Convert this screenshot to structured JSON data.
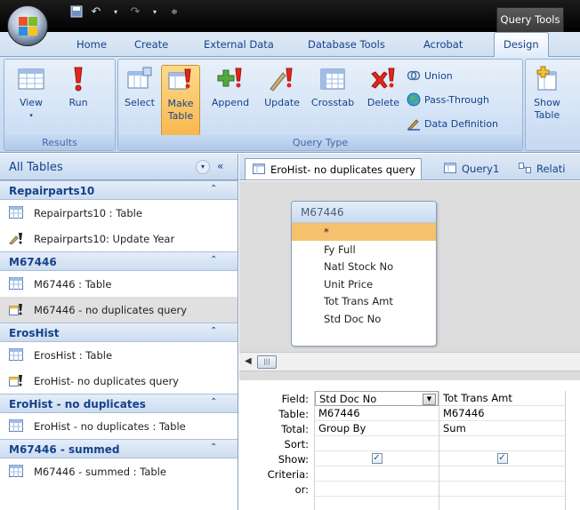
{
  "window": {
    "contextual_tab": "Query Tools"
  },
  "ribbon": {
    "tabs": [
      "Home",
      "Create",
      "External Data",
      "Database Tools",
      "Acrobat",
      "Design"
    ],
    "active_tab": "Design",
    "groups": {
      "results": {
        "label": "Results",
        "view": "View",
        "run": "Run"
      },
      "query_type": {
        "label": "Query Type",
        "select": "Select",
        "make_table_1": "Make",
        "make_table_2": "Table",
        "append": "Append",
        "update": "Update",
        "crosstab": "Crosstab",
        "delete": "Delete",
        "union": "Union",
        "pass_through": "Pass-Through",
        "data_definition": "Data Definition"
      },
      "query_setup": {
        "show_table_1": "Show",
        "show_table_2": "Table"
      }
    }
  },
  "nav": {
    "header": "All Tables",
    "groups": [
      {
        "title": "Repairparts10",
        "items": [
          {
            "label": "Repairparts10 : Table",
            "icon": "table-icon"
          },
          {
            "label": "Repairparts10: Update Year",
            "icon": "update-query-icon"
          }
        ]
      },
      {
        "title": "M67446",
        "items": [
          {
            "label": "M67446 : Table",
            "icon": "table-icon"
          },
          {
            "label": "M67446 - no duplicates query",
            "icon": "make-table-query-icon"
          }
        ]
      },
      {
        "title": "ErosHist",
        "items": [
          {
            "label": "ErosHist : Table",
            "icon": "table-icon"
          },
          {
            "label": "EroHist- no duplicates query",
            "icon": "make-table-query-icon"
          }
        ]
      },
      {
        "title": "EroHist - no duplicates",
        "items": [
          {
            "label": "EroHist - no duplicates : Table",
            "icon": "table-icon"
          }
        ]
      },
      {
        "title": "M67446 - summed",
        "items": [
          {
            "label": "M67446 - summed : Table",
            "icon": "table-icon"
          }
        ]
      }
    ]
  },
  "doc_tabs": [
    "EroHist- no duplicates query",
    "Query1",
    "Relati"
  ],
  "table_box": {
    "title": "M67446",
    "fields": [
      "*",
      "Fy Full",
      "Natl Stock No",
      "Unit Price",
      "Tot Trans Amt",
      "Std Doc No"
    ]
  },
  "grid": {
    "row_labels": [
      "Field:",
      "Table:",
      "Total:",
      "Sort:",
      "Show:",
      "Criteria:",
      "or:"
    ],
    "columns": [
      {
        "field": "Std Doc No",
        "table": "M67446",
        "total": "Group By",
        "sort": "",
        "show": true
      },
      {
        "field": "Tot Trans Amt",
        "table": "M67446",
        "total": "Sum",
        "sort": "",
        "show": true
      }
    ]
  },
  "colors": {
    "accent": "#f9b84f",
    "ribbon_text": "#15428b",
    "highlight_field": "#f6c06c"
  }
}
